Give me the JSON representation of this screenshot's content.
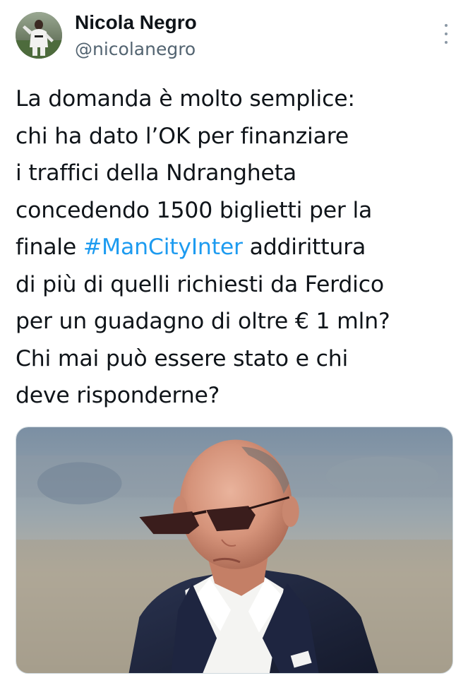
{
  "tweet": {
    "author": {
      "display_name": "Nicola Negro",
      "handle": "@nicolanegro",
      "avatar_icon": "avatar-photo"
    },
    "menu_icon": "more-vertical-icon",
    "text_lines": [
      {
        "before": "La domanda è molto semplice:",
        "hashtag": "",
        "after": ""
      },
      {
        "before": "chi ha dato l’OK per finanziare",
        "hashtag": "",
        "after": ""
      },
      {
        "before": "i traffici della Ndrangheta",
        "hashtag": "",
        "after": ""
      },
      {
        "before": "concedendo 1500 biglietti per la",
        "hashtag": "",
        "after": ""
      },
      {
        "before": "finale ",
        "hashtag": "#ManCityInter",
        "after": " addirittura"
      },
      {
        "before": "di più di quelli richiesti da Ferdico",
        "hashtag": "",
        "after": ""
      },
      {
        "before": "per un guadagno di oltre € 1 mln?",
        "hashtag": "",
        "after": ""
      },
      {
        "before": "Chi mai può essere stato e chi",
        "hashtag": "",
        "after": ""
      },
      {
        "before": "deve risponderne?",
        "hashtag": "",
        "after": ""
      }
    ],
    "colors": {
      "text": "#0f1419",
      "secondary": "#536471",
      "link": "#1d9bf0"
    },
    "media": {
      "kind": "photo"
    }
  }
}
